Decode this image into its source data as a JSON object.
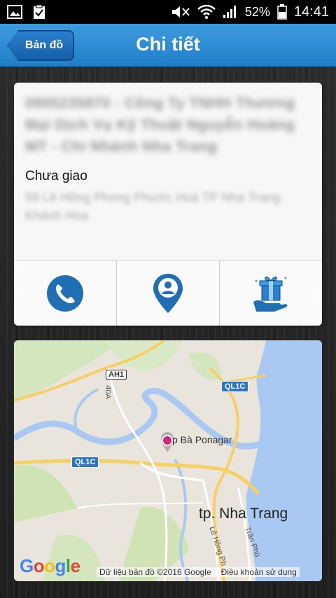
{
  "status_bar": {
    "battery": "52%",
    "time": "14:41"
  },
  "header": {
    "back_label": "Bản đồ",
    "title": "Chi tiết"
  },
  "card": {
    "name": "0905235870 - Công Ty TNHH Thương Mại Dịch Vụ Kỹ Thuật Nguyễn Hoàng MT - Chi Nhánh Nha Trang",
    "status": "Chưa giao",
    "address": "59 Lê Hồng Phong Phước Hoà TP Nha Trang Khánh Hòa",
    "actions": [
      {
        "icon": "phone-icon",
        "label": "call"
      },
      {
        "icon": "location-person-icon",
        "label": "location"
      },
      {
        "icon": "gift-hand-icon",
        "label": "gift"
      }
    ]
  },
  "map": {
    "labels": {
      "ah1": "AH1",
      "road_40a": "40A",
      "ql1c_left": "QL1C",
      "ql1c_right": "QL1C",
      "ponagar": "p Bà Ponagar",
      "city": "tp. Nha Trang",
      "le_hong_phong": "Lê Hồng Ph",
      "tran_phu": "Trần Phú"
    },
    "attribution": "Dữ liệu bản đồ ©2016 Google",
    "terms": "Điều khoản sử dụng",
    "logo": "Google",
    "colors": {
      "land": "#e9e5dc",
      "water": "#a9c9f3",
      "park": "#cfe3b4",
      "road_major": "#f6cf65",
      "pin": "#d6247b"
    }
  }
}
